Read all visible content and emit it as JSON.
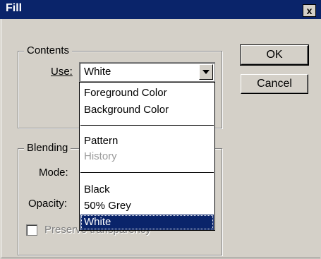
{
  "window": {
    "title": "Fill",
    "close_glyph": "x"
  },
  "contents": {
    "legend": "Contents",
    "use_label": "Use:",
    "use_value": "White",
    "options": [
      {
        "label": "Foreground Color",
        "state": "normal"
      },
      {
        "label": "Background Color",
        "state": "normal"
      },
      {
        "label": "Pattern",
        "state": "normal"
      },
      {
        "label": "History",
        "state": "disabled"
      },
      {
        "label": "Black",
        "state": "normal"
      },
      {
        "label": "50% Grey",
        "state": "normal"
      },
      {
        "label": "White",
        "state": "selected"
      }
    ]
  },
  "blending": {
    "legend": "Blending",
    "mode_label": "Mode:",
    "opacity_label": "Opacity:",
    "preserve_label": "Preserve transparency"
  },
  "buttons": {
    "ok": "OK",
    "cancel": "Cancel"
  },
  "colors": {
    "titlebar": "#0a246a",
    "dialog": "#d4d0c8",
    "highlight": "#0a246a"
  }
}
